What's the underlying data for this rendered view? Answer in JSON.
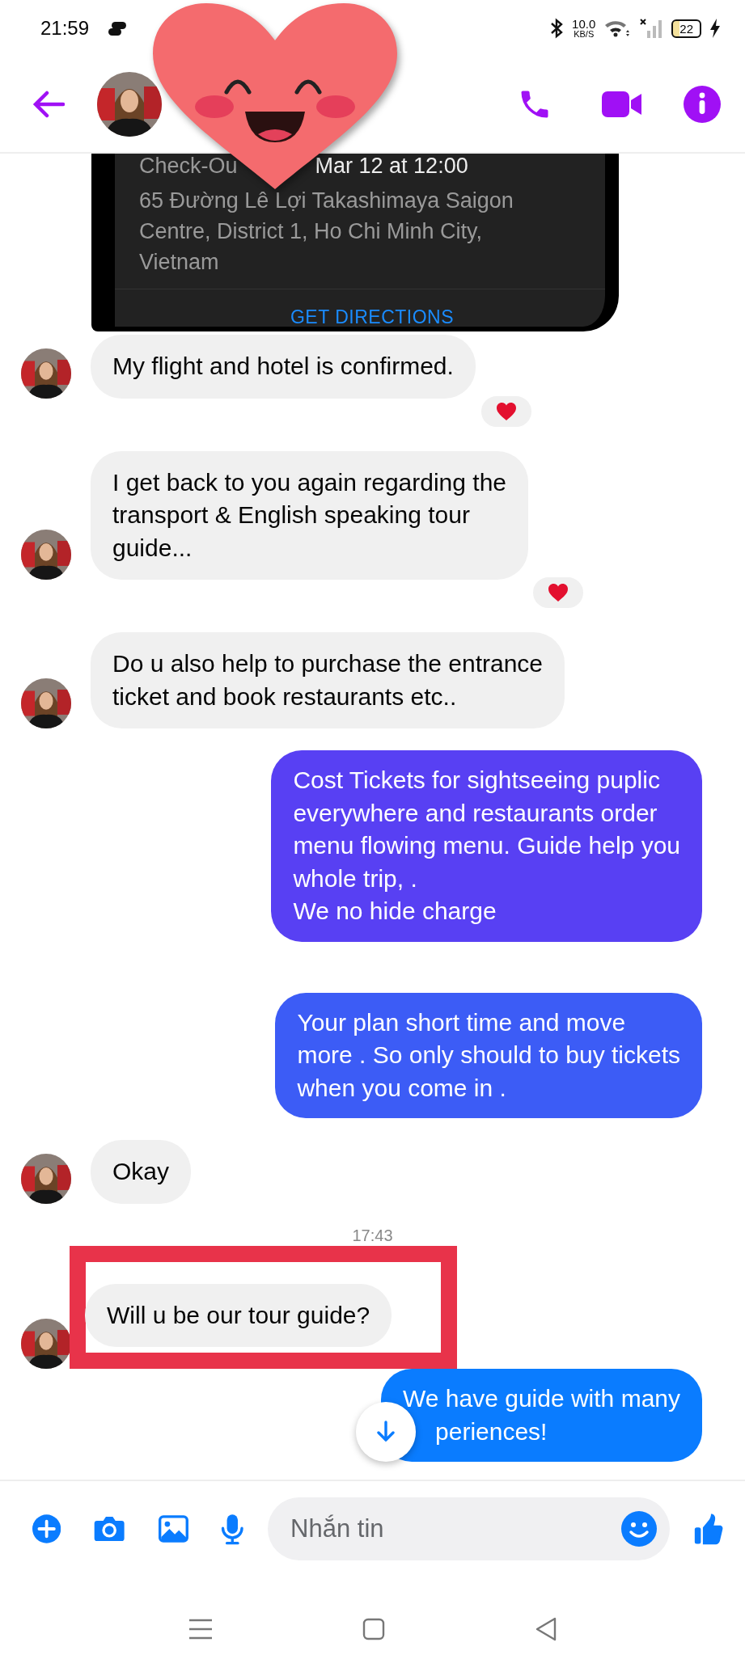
{
  "status_bar": {
    "time": "21:59",
    "net_speed": "10.0",
    "net_unit": "KB/S",
    "battery": "22"
  },
  "messages": [
    {
      "kind": "card",
      "lines": [
        "Check-Ou",
        "Mar 12 at 12:00"
      ],
      "address": [
        "65 Đường Lê Lợi Takashimaya Saigon",
        "Centre, District 1, Ho Chi Minh City,",
        "Vietnam"
      ],
      "link": "GET DIRECTIONS"
    },
    {
      "kind": "received",
      "lines": [
        "My flight and hotel is confirmed."
      ],
      "reaction": true,
      "highlighted": false
    },
    {
      "kind": "received",
      "lines": [
        "I get back to you again regarding the",
        "transport & English speaking tour",
        "guide..."
      ],
      "reaction": true,
      "highlighted": false
    },
    {
      "kind": "received",
      "lines": [
        "Do u also help to purchase the entrance",
        "ticket and book restaurants etc.."
      ],
      "reaction": false,
      "highlighted": false
    },
    {
      "kind": "sent",
      "lines": [
        "Cost Tickets for sightseeing puplic",
        "everywhere and restaurants order",
        "menu flowing menu. Guide help you",
        "whole trip, .",
        "We no hide charge"
      ],
      "color": "#5840f3"
    },
    {
      "kind": "sent",
      "lines": [
        "Your plan short time and move",
        "more . So only should to buy tickets",
        "when you come in ."
      ],
      "color": "#3c5cf6"
    },
    {
      "kind": "received",
      "lines": [
        "Okay"
      ],
      "reaction": false,
      "highlighted": false
    },
    {
      "kind": "timestamp",
      "text": "17:43"
    },
    {
      "kind": "received",
      "lines": [
        "Will u be our tour guide?"
      ],
      "reaction": false,
      "highlighted": true
    },
    {
      "kind": "sent",
      "lines": [
        "We have guide with many",
        "periences!"
      ],
      "color": "#0a7cff"
    }
  ],
  "composer": {
    "placeholder": "Nhắn tin"
  }
}
